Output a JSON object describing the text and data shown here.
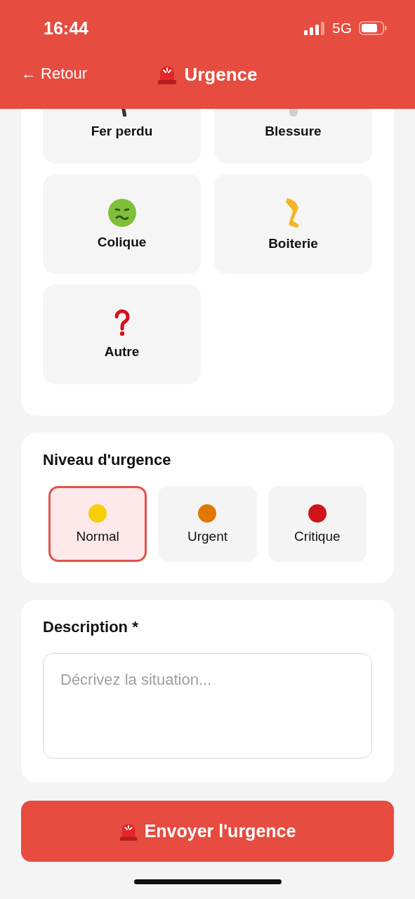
{
  "status_bar": {
    "time": "16:44",
    "network": "5G"
  },
  "header": {
    "back": "← Retour",
    "title": "Urgence"
  },
  "categories": [
    {
      "label": "Fer perdu",
      "selected": false
    },
    {
      "label": "Blessure",
      "selected": false
    },
    {
      "label": "Colique",
      "selected": false
    },
    {
      "label": "Boiterie",
      "selected": false
    },
    {
      "label": "Autre",
      "selected": false
    }
  ],
  "urgency": {
    "title": "Niveau d'urgence",
    "levels": [
      {
        "label": "Normal",
        "color": "#f5cf00",
        "selected": true
      },
      {
        "label": "Urgent",
        "color": "#e07800",
        "selected": false
      },
      {
        "label": "Critique",
        "color": "#d0141a",
        "selected": false
      }
    ]
  },
  "description": {
    "title": "Description *",
    "placeholder": "Décrivez la situation..."
  },
  "submit": {
    "label": "Envoyer l'urgence"
  }
}
